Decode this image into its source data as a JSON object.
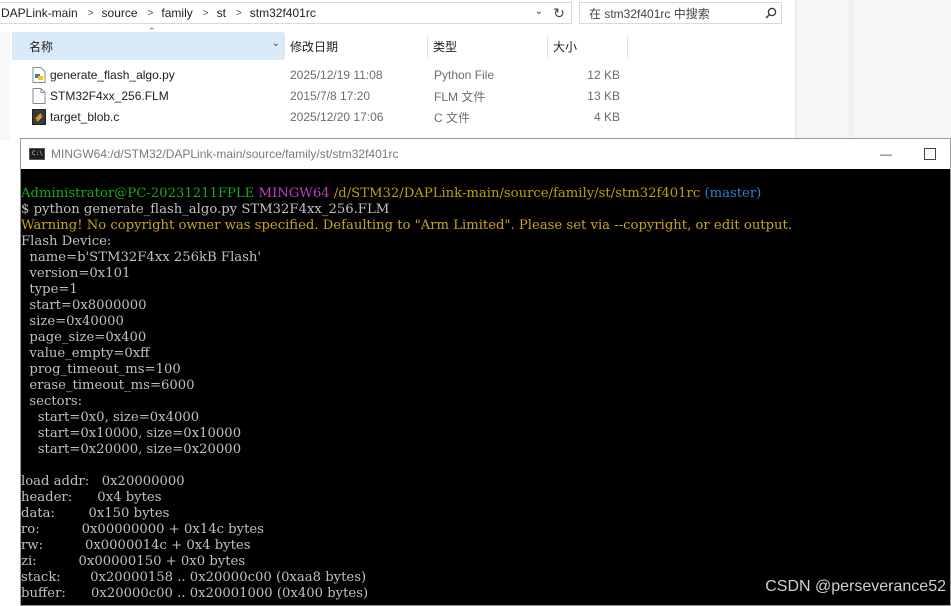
{
  "explorer": {
    "breadcrumb": [
      "DAPLink-main",
      "source",
      "family",
      "st",
      "stm32f401rc"
    ],
    "search_placeholder": "在 stm32f401rc 中搜索",
    "columns": {
      "name": "名称",
      "modified": "修改日期",
      "type": "类型",
      "size": "大小"
    },
    "files": [
      {
        "name": "generate_flash_algo.py",
        "modified": "2025/12/19 11:08",
        "type": "Python File",
        "size": "12 KB",
        "icon": "python-file-icon"
      },
      {
        "name": "STM32F4xx_256.FLM",
        "modified": "2015/7/8 17:20",
        "type": "FLM 文件",
        "size": "13 KB",
        "icon": "generic-file-icon"
      },
      {
        "name": "target_blob.c",
        "modified": "2025/12/20 17:06",
        "type": "C 文件",
        "size": "4 KB",
        "icon": "c-file-icon"
      }
    ]
  },
  "terminal": {
    "title": "MINGW64:/d/STM32/DAPLink-main/source/family/st/stm32f401rc",
    "prompt": {
      "user": "Administrator@PC-20231211FPLE",
      "shell": "MINGW64",
      "path": "/d/STM32/DAPLink-main/source/family/st/stm32f401rc",
      "branch": "(master)"
    },
    "command": "$ python generate_flash_algo.py STM32F4xx_256.FLM",
    "warning": "Warning! No copyright owner was specified. Defaulting to \"Arm Limited\". Please set via --copyright, or edit output.",
    "output": [
      "Flash Device:",
      "  name=b'STM32F4xx 256kB Flash'",
      "  version=0x101",
      "  type=1",
      "  start=0x8000000",
      "  size=0x40000",
      "  page_size=0x400",
      "  value_empty=0xff",
      "  prog_timeout_ms=100",
      "  erase_timeout_ms=6000",
      "  sectors:",
      "    start=0x0, size=0x4000",
      "    start=0x10000, size=0x10000",
      "    start=0x20000, size=0x20000",
      "",
      "load addr:   0x20000000",
      "header:      0x4 bytes",
      "data:        0x150 bytes",
      "ro:          0x00000000 + 0x14c bytes",
      "rw:          0x0000014c + 0x4 bytes",
      "zi:          0x00000150 + 0x0 bytes",
      "stack:       0x20000158 .. 0x20000c00 (0xaa8 bytes)",
      "buffer:      0x20000c00 .. 0x20001000 (0x400 bytes)"
    ]
  },
  "watermark": "CSDN @perseverance52",
  "colors": {
    "prompt_user": "#19a819",
    "prompt_shell": "#bf3fbf",
    "prompt_path": "#c0a000",
    "prompt_branch": "#2f7fd0",
    "warning": "#c9a41a",
    "selected_header": "#d9ebf9"
  }
}
